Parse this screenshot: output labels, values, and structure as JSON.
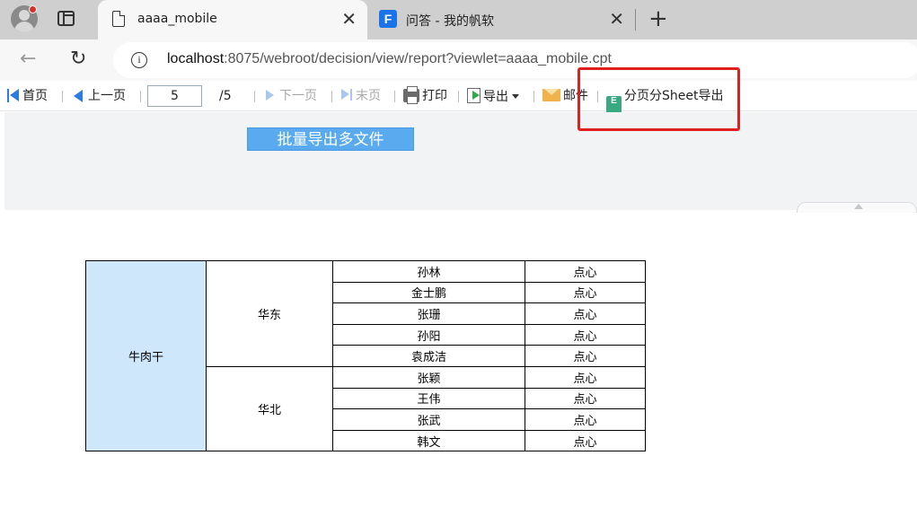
{
  "browser": {
    "tabs": [
      {
        "title": "aaaa_mobile",
        "active": true
      },
      {
        "title": "问答 - 我的帆软",
        "active": false
      }
    ],
    "close_glyph": "✕",
    "new_tab_glyph": "+",
    "url_host": "localhost",
    "url_rest": ":8075/webroot/decision/view/report?viewlet=aaaa_mobile.cpt"
  },
  "toolbar": {
    "first": "首页",
    "prev": "上一页",
    "page_current": "5",
    "page_total": "/5",
    "next": "下一页",
    "last": "末页",
    "print": "打印",
    "export": "导出",
    "mail": "邮件",
    "sheet_export": "分页分Sheet导出"
  },
  "panel": {
    "batch_export": "批量导出多文件"
  },
  "report": {
    "product": "牛肉干",
    "regions": [
      {
        "name": "华东",
        "rows": [
          {
            "person": "孙林",
            "category": "点心"
          },
          {
            "person": "金士鹏",
            "category": "点心"
          },
          {
            "person": "张珊",
            "category": "点心"
          },
          {
            "person": "孙阳",
            "category": "点心"
          },
          {
            "person": "袁成洁",
            "category": "点心"
          }
        ]
      },
      {
        "name": "华北",
        "rows": [
          {
            "person": "张颖",
            "category": "点心"
          },
          {
            "person": "王伟",
            "category": "点心"
          },
          {
            "person": "张武",
            "category": "点心"
          },
          {
            "person": "韩文",
            "category": "点心"
          }
        ]
      }
    ]
  },
  "colors": {
    "highlight_box": "#e21f1f",
    "product_cell_bg": "#cfe7fb",
    "batch_button_bg": "#5aaaf0",
    "nav_icon_active": "#2d7be0",
    "nav_icon_disabled": "#a9c6ee"
  },
  "icons": [
    "profile-avatar",
    "tab-actions-icon",
    "document-icon",
    "fanruan-icon",
    "back-arrow-icon",
    "reload-icon",
    "info-icon",
    "first-page-icon",
    "prev-page-icon",
    "next-page-icon",
    "last-page-icon",
    "print-icon",
    "export-icon",
    "mail-icon",
    "excel-icon"
  ]
}
